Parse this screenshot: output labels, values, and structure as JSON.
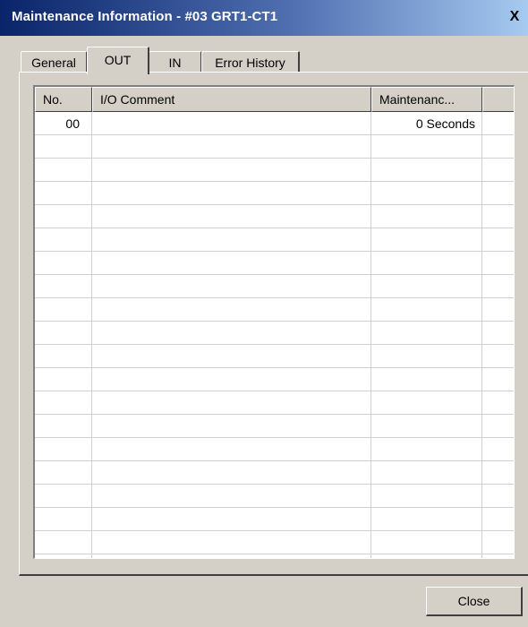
{
  "window": {
    "title": "Maintenance Information - #03 GRT1-CT1",
    "close_glyph": "X"
  },
  "tabs": [
    {
      "label": "General",
      "active": false
    },
    {
      "label": "OUT",
      "active": true
    },
    {
      "label": "IN",
      "active": false
    },
    {
      "label": "Error History",
      "active": false
    }
  ],
  "table": {
    "columns": [
      "No.",
      "I/O Comment",
      "Maintenanc..."
    ],
    "rows": [
      {
        "no": "00",
        "comment": "",
        "maintenance": "0 Seconds"
      }
    ]
  },
  "buttons": {
    "close_label": "Close"
  }
}
